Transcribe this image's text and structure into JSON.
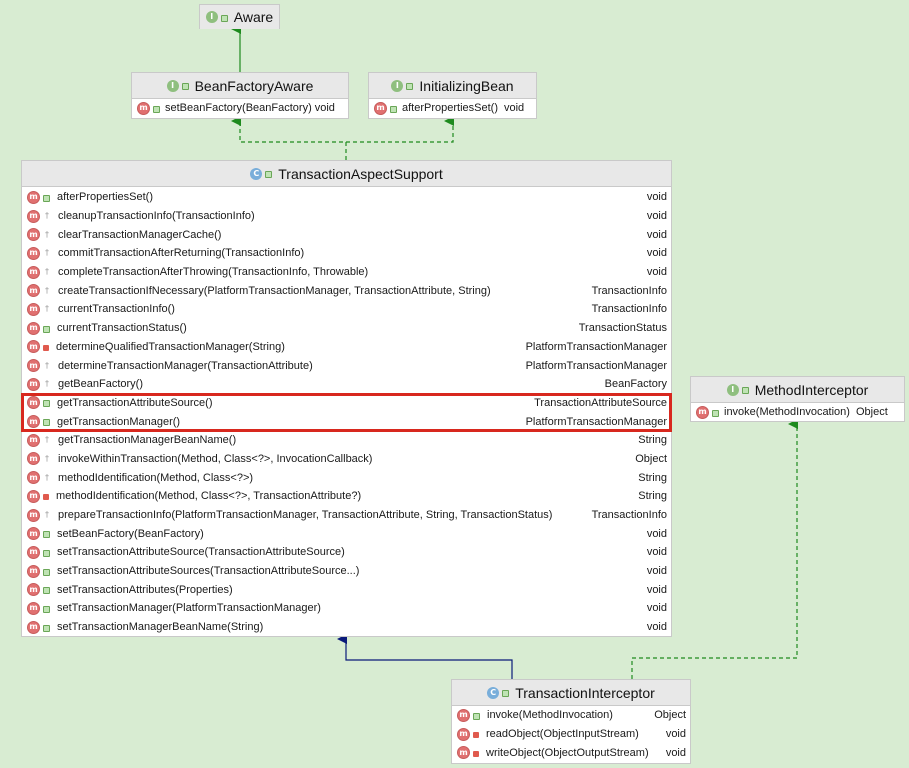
{
  "diagram": {
    "aware": {
      "title": "Aware",
      "kind": "I"
    },
    "bean_factory_aware": {
      "title": "BeanFactoryAware",
      "kind": "I",
      "methods": [
        {
          "name": "setBeanFactory(BeanFactory)",
          "ret": "void"
        }
      ]
    },
    "initializing_bean": {
      "title": "InitializingBean",
      "kind": "I",
      "methods": [
        {
          "name": "afterPropertiesSet()",
          "ret": "void"
        }
      ]
    },
    "transaction_aspect_support": {
      "title": "TransactionAspectSupport",
      "kind": "C",
      "methods": [
        {
          "name": "afterPropertiesSet()",
          "ret": "void",
          "vis": "pub"
        },
        {
          "name": "cleanupTransactionInfo(TransactionInfo)",
          "ret": "void",
          "vis": "prot"
        },
        {
          "name": "clearTransactionManagerCache()",
          "ret": "void",
          "vis": "prot"
        },
        {
          "name": "commitTransactionAfterReturning(TransactionInfo)",
          "ret": "void",
          "vis": "prot"
        },
        {
          "name": "completeTransactionAfterThrowing(TransactionInfo, Throwable)",
          "ret": "void",
          "vis": "prot"
        },
        {
          "name": "createTransactionIfNecessary(PlatformTransactionManager, TransactionAttribute, String)",
          "ret": "TransactionInfo",
          "vis": "prot"
        },
        {
          "name": "currentTransactionInfo()",
          "ret": "TransactionInfo",
          "vis": "prot"
        },
        {
          "name": "currentTransactionStatus()",
          "ret": "TransactionStatus",
          "vis": "pub"
        },
        {
          "name": "determineQualifiedTransactionManager(String)",
          "ret": "PlatformTransactionManager",
          "vis": "priv"
        },
        {
          "name": "determineTransactionManager(TransactionAttribute)",
          "ret": "PlatformTransactionManager",
          "vis": "prot"
        },
        {
          "name": "getBeanFactory()",
          "ret": "BeanFactory",
          "vis": "prot"
        },
        {
          "name": "getTransactionAttributeSource()",
          "ret": "TransactionAttributeSource",
          "vis": "pub"
        },
        {
          "name": "getTransactionManager()",
          "ret": "PlatformTransactionManager",
          "vis": "pub"
        },
        {
          "name": "getTransactionManagerBeanName()",
          "ret": "String",
          "vis": "prot"
        },
        {
          "name": "invokeWithinTransaction(Method, Class<?>, InvocationCallback)",
          "ret": "Object",
          "vis": "prot"
        },
        {
          "name": "methodIdentification(Method, Class<?>)",
          "ret": "String",
          "vis": "prot"
        },
        {
          "name": "methodIdentification(Method, Class<?>, TransactionAttribute?)",
          "ret": "String",
          "vis": "priv"
        },
        {
          "name": "prepareTransactionInfo(PlatformTransactionManager, TransactionAttribute, String, TransactionStatus)",
          "ret": "TransactionInfo",
          "vis": "prot"
        },
        {
          "name": "setBeanFactory(BeanFactory)",
          "ret": "void",
          "vis": "pub"
        },
        {
          "name": "setTransactionAttributeSource(TransactionAttributeSource)",
          "ret": "void",
          "vis": "pub"
        },
        {
          "name": "setTransactionAttributeSources(TransactionAttributeSource...)",
          "ret": "void",
          "vis": "pub"
        },
        {
          "name": "setTransactionAttributes(Properties)",
          "ret": "void",
          "vis": "pub"
        },
        {
          "name": "setTransactionManager(PlatformTransactionManager)",
          "ret": "void",
          "vis": "pub"
        },
        {
          "name": "setTransactionManagerBeanName(String)",
          "ret": "void",
          "vis": "pub"
        }
      ]
    },
    "method_interceptor": {
      "title": "MethodInterceptor",
      "kind": "I",
      "methods": [
        {
          "name": "invoke(MethodInvocation)",
          "ret": "Object"
        }
      ]
    },
    "transaction_interceptor": {
      "title": "TransactionInterceptor",
      "kind": "C",
      "methods": [
        {
          "name": "invoke(MethodInvocation)",
          "ret": "Object",
          "vis": "pub"
        },
        {
          "name": "readObject(ObjectInputStream)",
          "ret": "void",
          "vis": "priv"
        },
        {
          "name": "writeObject(ObjectOutputStream)",
          "ret": "void",
          "vis": "priv"
        }
      ]
    },
    "colors": {
      "background": "#d8ecd2",
      "implements_edge": "#1e8a1e",
      "extends_edge": "#0a1a7a",
      "highlight": "#d8281e"
    }
  }
}
